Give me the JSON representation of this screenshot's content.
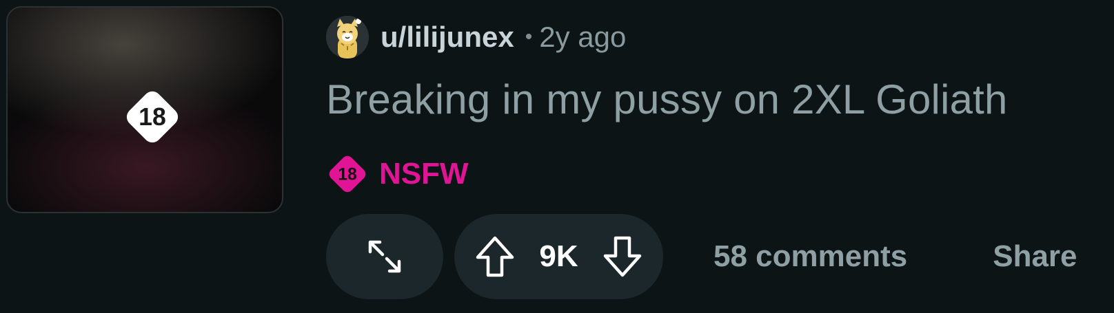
{
  "post": {
    "thumbnail": {
      "badge_text": "18",
      "icon": "nsfw-18-badge-icon"
    },
    "author": "u/lilijunex",
    "separator": "•",
    "time_ago": "2y ago",
    "title": "Breaking in my pussy on 2XL Goliath",
    "flair": {
      "badge_text": "18",
      "label": "NSFW",
      "color": "#e11495"
    },
    "actions": {
      "expand_icon": "expand-arrows-icon",
      "upvote_icon": "upvote-arrow-icon",
      "score": "9K",
      "downvote_icon": "downvote-arrow-icon",
      "comments": "58 comments",
      "share": "Share"
    }
  },
  "colors": {
    "background": "#0c1416",
    "button_bg": "#1c272b",
    "nsfw": "#e11495",
    "text_muted": "#8fa0a5"
  }
}
